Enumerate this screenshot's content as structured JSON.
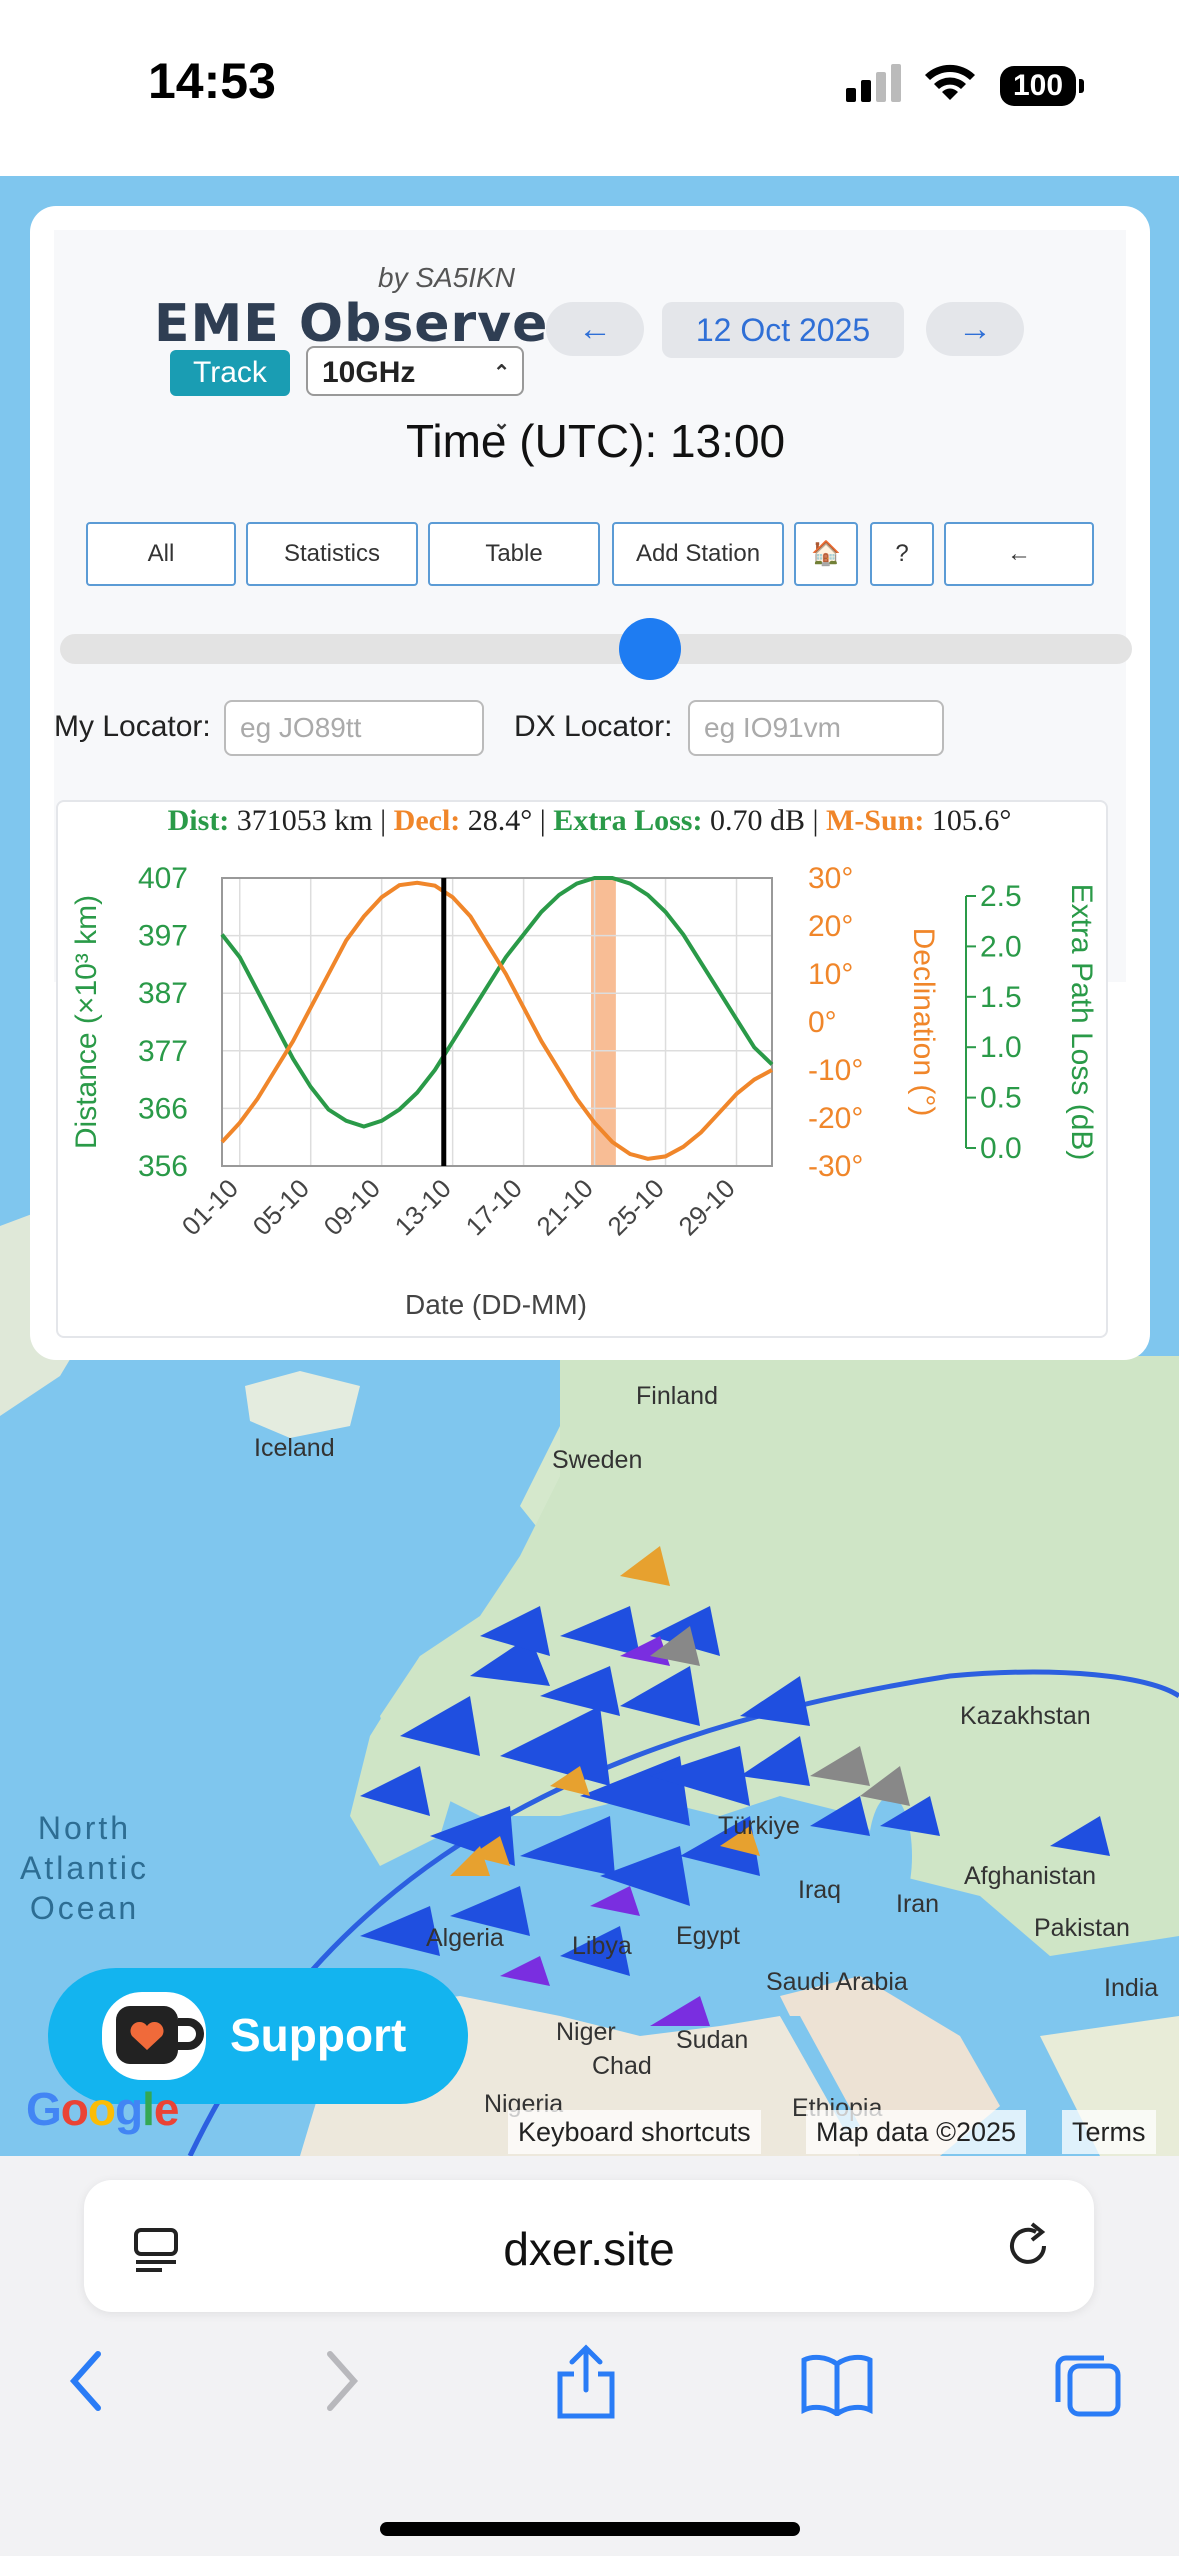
{
  "status": {
    "time": "14:53",
    "battery": "100"
  },
  "header": {
    "byline": "by SA5IKN",
    "title": "EME Observer",
    "prev_label": "←",
    "next_label": "→",
    "date": "12 Oct 2025",
    "track_label": "Track",
    "band": "10GHz",
    "time_utc": "Time (UTC): 13:00"
  },
  "toolbar": {
    "all": "All",
    "statistics": "Statistics",
    "table": "Table",
    "add_station": "Add Station",
    "home": "🏠",
    "help": "?",
    "back": "←"
  },
  "slider": {
    "value_fraction": 0.55
  },
  "locators": {
    "my_label": "My Locator:",
    "my_placeholder": "eg JO89tt",
    "dx_label": "DX Locator:",
    "dx_placeholder": "eg IO91vm"
  },
  "summary": {
    "dist_label": "Dist:",
    "dist_value": "371053 km",
    "decl_label": "Decl:",
    "decl_value": "28.4°",
    "loss_label": "Extra Loss:",
    "loss_value": "0.70 dB",
    "msun_label": "M-Sun:",
    "msun_value": "105.6°"
  },
  "chart_data": {
    "type": "line",
    "xlabel": "Date (DD-MM)",
    "x_ticks": [
      "01-10",
      "05-10",
      "09-10",
      "13-10",
      "17-10",
      "21-10",
      "25-10",
      "29-10"
    ],
    "y_left": {
      "label": "Distance (×10³ km)",
      "ticks": [
        "407",
        "397",
        "387",
        "377",
        "366",
        "356"
      ],
      "range": [
        356,
        407
      ]
    },
    "y_mid": {
      "label": "Declination (°)",
      "ticks": [
        "30°",
        "20°",
        "10°",
        "0°",
        "-10°",
        "-20°",
        "-30°"
      ],
      "range": [
        -30,
        30
      ]
    },
    "y_right": {
      "label": "Extra Path Loss (dB)",
      "ticks": [
        "2.5",
        "2.0",
        "1.5",
        "1.0",
        "0.5",
        "0.0"
      ],
      "range": [
        0,
        2.5
      ]
    },
    "current_day": 12.5,
    "highlight_range": [
      20.8,
      22.2
    ],
    "series": [
      {
        "color": "#2a9a48",
        "x": [
          0,
          1,
          2,
          3,
          4,
          5,
          6,
          7,
          8,
          9,
          10,
          11,
          12,
          13,
          14,
          15,
          16,
          17,
          18,
          19,
          20,
          21,
          22,
          23,
          24,
          25,
          26,
          27,
          28,
          29,
          30,
          31
        ],
        "y": [
          397,
          393,
          387,
          381,
          375,
          370,
          366,
          364,
          363,
          364,
          366,
          369,
          373,
          378,
          383,
          388,
          393,
          397,
          401,
          404,
          406,
          407,
          407,
          406,
          404,
          401,
          397,
          392,
          387,
          382,
          377,
          374
        ]
      },
      {
        "color": "#f0862a",
        "x": [
          0,
          1,
          2,
          3,
          4,
          5,
          6,
          7,
          8,
          9,
          10,
          11,
          12,
          13,
          14,
          15,
          16,
          17,
          18,
          19,
          20,
          21,
          22,
          23,
          24,
          25,
          26,
          27,
          28,
          29,
          30,
          31
        ],
        "y": [
          -25,
          -21,
          -16,
          -10,
          -4,
          3,
          10,
          17,
          22,
          26,
          28.5,
          29,
          28.4,
          26,
          22,
          16,
          10,
          3,
          -4,
          -10,
          -16,
          -21,
          -25,
          -27.5,
          -28.5,
          -28,
          -26,
          -23,
          -19,
          -15,
          -12,
          -10
        ]
      }
    ]
  },
  "map": {
    "labels": {
      "finland": "Finland",
      "iceland": "Iceland",
      "sweden": "Sweden",
      "kazakhstan": "Kazakhstan",
      "turkiye": "Türkiye",
      "ocean": "North\nAtlantic\nOcean",
      "iraq": "Iraq",
      "iran": "Iran",
      "afghanistan": "Afghanistan",
      "pakistan": "Pakistan",
      "algeria": "Algeria",
      "libya": "Libya",
      "egypt": "Egypt",
      "saudi": "Saudi Arabia",
      "india": "India",
      "niger": "Niger",
      "sudan": "Sudan",
      "chad": "Chad",
      "nigeria": "Nigeria",
      "ethiopia": "Ethiopia"
    },
    "support_label": "Support",
    "google": "Google",
    "shortcuts": "Keyboard shortcuts",
    "mapdata": "Map data ©2025",
    "terms": "Terms"
  },
  "browser": {
    "url": "dxer.site"
  }
}
